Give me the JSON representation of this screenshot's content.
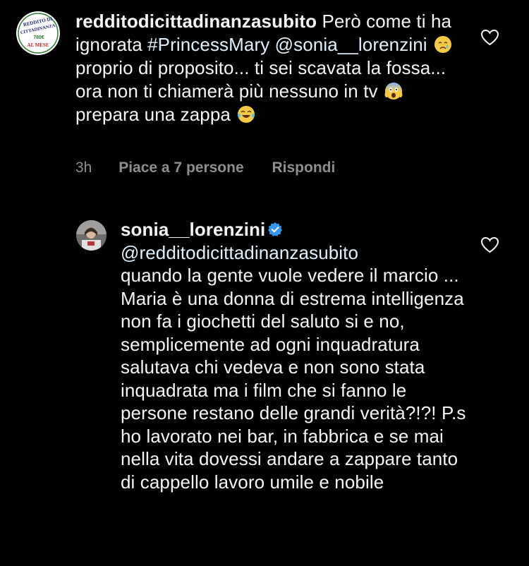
{
  "comments": [
    {
      "username": "redditodicittadinanzasubito",
      "text_parts": {
        "p1": "Però come ti ha ignorata ",
        "hashtag": "#PrincessMary",
        "mention": "@sonia__lorenzini",
        "p2": " proprio di proposito... ti sei scavata la fossa... ora non ti chiamerà più nessuno in tv ",
        "p3": " prepara una zappa "
      },
      "avatar_logo": {
        "line1": "REDDITO DI",
        "line2": "CITTADINANZA",
        "line3": "780€",
        "line4": "AL MESE"
      },
      "time": "3h",
      "likes": "Piace a 7 persone",
      "reply": "Rispondi"
    },
    {
      "username": "sonia__lorenzini",
      "verified": true,
      "mention": "@redditodicittadinanzasubito",
      "text": "quando la gente vuole vedere il marcio ... Maria è una donna di estrema intelligenza non fa i giochetti del saluto si e no, semplicemente ad ogni inquadratura salutava chi vedeva e non sono stata inquadrata ma i film che si fanno le persone restano delle grandi verità?!?! P.s ho lavorato nei bar, in fabbrica e se mai nella vita dovessi andare a zappare tanto di cappello lavoro umile e nobile"
    }
  ],
  "colors": {
    "background": "#000000",
    "text": "#f5f5f5",
    "secondary": "#8e8e8e",
    "verified": "#3797f0",
    "logo_red": "#c62828",
    "logo_blue": "#1a237e",
    "logo_green": "#2e7d32"
  },
  "icons": [
    "heart-icon",
    "verified-badge-icon",
    "crying-face-emoji",
    "screaming-face-emoji",
    "tears-of-joy-emoji"
  ]
}
